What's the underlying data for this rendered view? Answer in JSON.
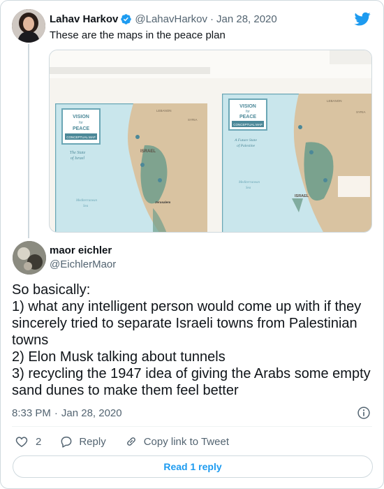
{
  "parent_tweet": {
    "author_name": "Lahav Harkov",
    "handle": "@LahavHarkov",
    "separator": "·",
    "date": "Jan 28, 2020",
    "text": "These are the maps in the peace plan",
    "media": {
      "left_map": {
        "badge_line1": "VISION",
        "badge_line2": "for",
        "badge_line3": "PEACE",
        "badge_line4": "CONCEPTUAL MAP",
        "subtitle_line1": "The State",
        "subtitle_line2": "of Israel",
        "labels": [
          "LEBANON",
          "SYRIA",
          "ISRAEL",
          "Mediterranean",
          "Sea",
          "Jerusalem"
        ]
      },
      "right_map": {
        "badge_line1": "VISION",
        "badge_line2": "for",
        "badge_line3": "PEACE",
        "badge_line4": "CONCEPTUAL MAP",
        "subtitle_line1": "A Future State",
        "subtitle_line2": "of Palestine",
        "labels": [
          "LEBANON",
          "SYRIA",
          "ISRAEL",
          "Mediterranean",
          "Sea"
        ]
      }
    }
  },
  "reply_tweet": {
    "author_name": "maor eichler",
    "handle": "@EichlerMaor",
    "text_lines": [
      "So basically:",
      "1) what any intelligent person would come up with if they",
      "sincerely tried to separate Israeli towns from Palestinian",
      "towns",
      "2) Elon Musk talking about tunnels",
      "3) recycling the 1947 idea of giving the Arabs some empty",
      "sand dunes to make them feel better"
    ],
    "time": "8:33 PM",
    "separator": "·",
    "date": "Jan 28, 2020",
    "likes": "2",
    "reply_label": "Reply",
    "copy_link_label": "Copy link to Tweet",
    "read_replies_label": "Read 1 reply"
  },
  "colors": {
    "accent": "#1d9bf0",
    "secondary_text": "#536471",
    "border": "#cfd9de",
    "map_sea": "#c9e6ec",
    "map_land": "#d9c3a1",
    "map_frame": "#6aa6b5",
    "map_territory": "#6f9e8c"
  },
  "icons": [
    "verified-badge-icon",
    "twitter-bird-icon",
    "info-icon",
    "heart-icon",
    "reply-icon",
    "link-icon"
  ]
}
